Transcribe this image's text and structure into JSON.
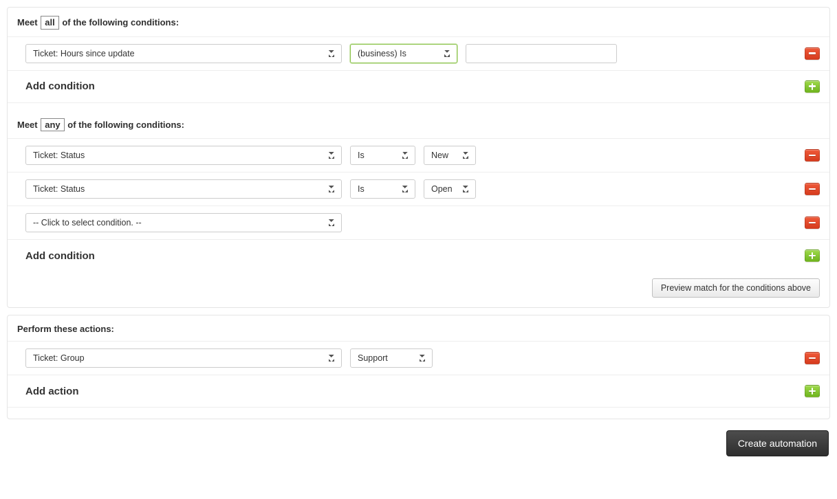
{
  "sections": {
    "all": {
      "header_prefix": "Meet",
      "header_box": "all",
      "header_suffix": "of the following conditions:",
      "rows": [
        {
          "field": "Ticket: Hours since update",
          "operator": "(business) Is",
          "value": ""
        }
      ],
      "add_label": "Add condition"
    },
    "any": {
      "header_prefix": "Meet",
      "header_box": "any",
      "header_suffix": "of the following conditions:",
      "rows": [
        {
          "field": "Ticket: Status",
          "operator": "Is",
          "value": "New"
        },
        {
          "field": "Ticket: Status",
          "operator": "Is",
          "value": "Open"
        },
        {
          "field": "-- Click to select condition. --"
        }
      ],
      "add_label": "Add condition"
    },
    "preview_button": "Preview match for the conditions above"
  },
  "actions": {
    "header": "Perform these actions:",
    "rows": [
      {
        "field": "Ticket: Group",
        "value": "Support"
      }
    ],
    "add_label": "Add action"
  },
  "footer": {
    "submit": "Create automation"
  }
}
